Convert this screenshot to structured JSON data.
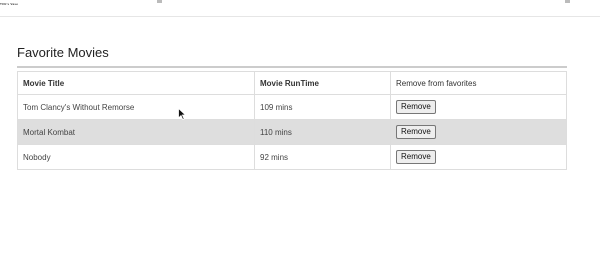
{
  "header": {
    "brand_text": "TCE's Vase"
  },
  "page": {
    "title": "Favorite Movies"
  },
  "table": {
    "headers": [
      "Movie Title",
      "Movie RunTime",
      "Remove from favorites"
    ],
    "rows": [
      {
        "title": "Tom Clancy's Without Remorse",
        "runtime": "109 mins",
        "action": "Remove"
      },
      {
        "title": "Mortal Kombat",
        "runtime": "110 mins",
        "action": "Remove"
      },
      {
        "title": "Nobody",
        "runtime": "92 mins",
        "action": "Remove"
      }
    ]
  },
  "colors": {
    "row_alt": "#dedede",
    "border": "#dddddd"
  }
}
